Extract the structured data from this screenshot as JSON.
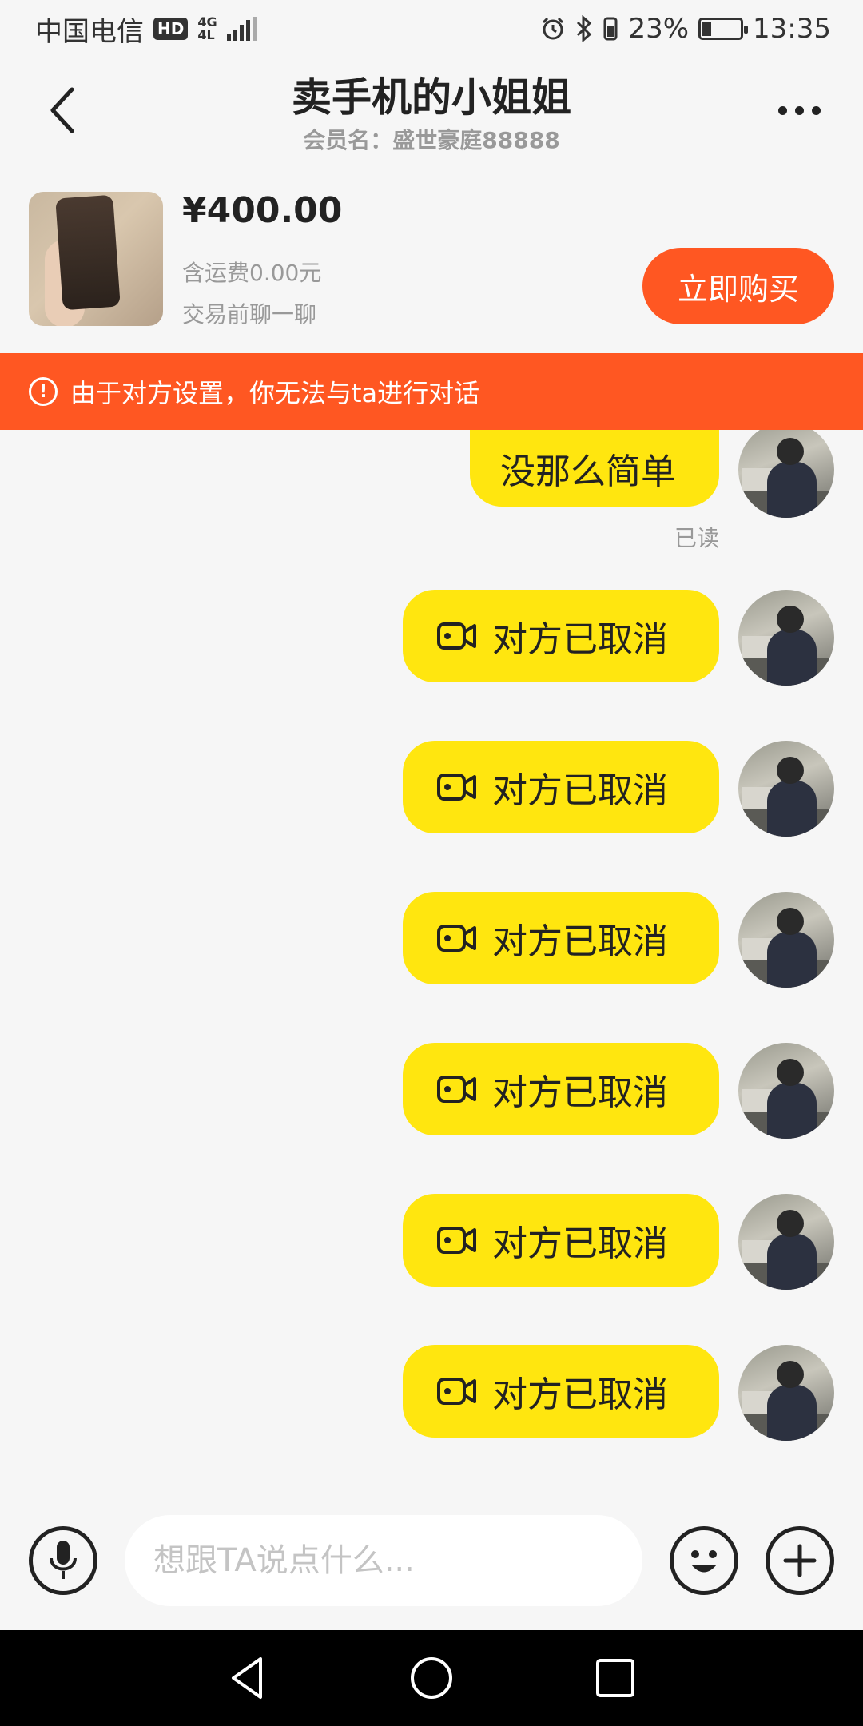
{
  "status_bar": {
    "carrier": "中国电信",
    "hd_badge": "HD",
    "net_type_top": "4G",
    "net_type_bottom": "4L",
    "battery_percent": "23%",
    "battery_level": 0.23,
    "time": "13:35"
  },
  "header": {
    "title": "卖手机的小姐姐",
    "subtitle": "会员名：盛世豪庭88888"
  },
  "product": {
    "price": "¥400.00",
    "shipping": "含运费0.00元",
    "note": "交易前聊一聊",
    "buy_label": "立即购买"
  },
  "banner": {
    "icon": "!",
    "text": "由于对方设置，你无法与ta进行对话"
  },
  "messages": {
    "text_message": "没那么简单",
    "read_status": "已读",
    "video_calls": [
      {
        "label": "对方已取消"
      },
      {
        "label": "对方已取消"
      },
      {
        "label": "对方已取消"
      },
      {
        "label": "对方已取消"
      },
      {
        "label": "对方已取消"
      },
      {
        "label": "对方已取消"
      }
    ]
  },
  "input_bar": {
    "placeholder": "想跟TA说点什么..."
  },
  "colors": {
    "accent": "#ff5722",
    "bubble": "#ffe60f",
    "background": "#f6f6f6"
  }
}
